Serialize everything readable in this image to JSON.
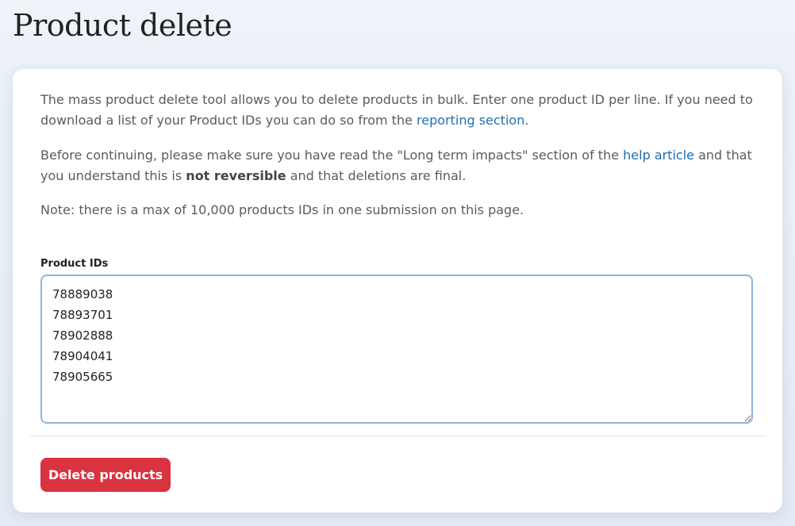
{
  "page": {
    "title": "Product delete"
  },
  "intro": {
    "p1_text": "The mass product delete tool allows you to delete products in bulk. Enter one product ID per line. If you need to download a list of your Product IDs you can do so from the ",
    "p1_link": "reporting section",
    "p1_end": ".",
    "p2_text_a": "Before continuing, please make sure you have read the \"Long term impacts\" section of the ",
    "p2_link": "help article",
    "p2_text_b": " and that you understand this is ",
    "p2_strong": "not reversible",
    "p2_text_c": " and that deletions are final.",
    "p3_text": "Note: there is a max of 10,000 products IDs in one submission on this page."
  },
  "form": {
    "product_ids_label": "Product IDs",
    "product_ids_value": "78889038\n78893701\n78902888\n78904041\n78905665",
    "submit_label": "Delete products"
  },
  "colors": {
    "link": "#1f6fb0",
    "danger": "#d9333f",
    "input_focus_border": "#8fb3e0"
  }
}
